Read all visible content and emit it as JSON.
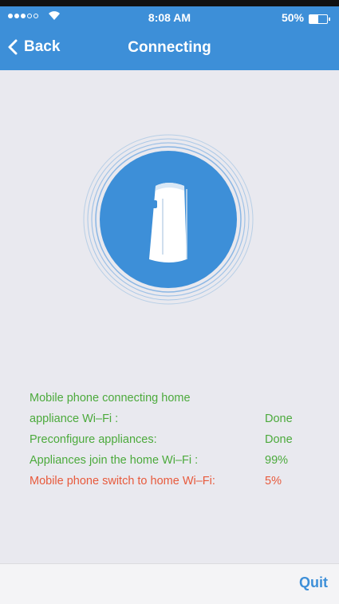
{
  "status_bar": {
    "time": "8:08 AM",
    "battery": "50%",
    "battery_level": 0.5,
    "signal_bars": 3,
    "signal_total": 5
  },
  "nav": {
    "back_label": "Back",
    "title": "Connecting"
  },
  "device": {
    "icon": "portable-air-conditioner-icon",
    "accent": "#3d8fd8"
  },
  "progress": {
    "steps": [
      {
        "label": "Mobile phone connecting home",
        "value": ""
      },
      {
        "label": "appliance Wi–Fi :",
        "value": "Done"
      },
      {
        "label": "Preconfigure appliances:",
        "value": "Done"
      },
      {
        "label": "Appliances join the home Wi–Fi :",
        "value": "99%"
      },
      {
        "label": "Mobile phone switch to home Wi–Fi:",
        "value": "5%"
      }
    ],
    "active_color": "#4caa3c",
    "pending_color": "#e85a3c"
  },
  "footer": {
    "quit_label": "Quit"
  }
}
